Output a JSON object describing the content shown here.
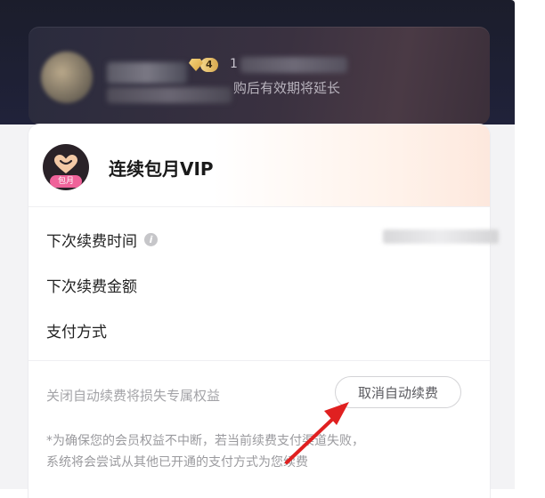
{
  "banner": {
    "level": "4",
    "level_prefix": "1",
    "description": "购后有效期将延长"
  },
  "vip_card": {
    "avatar_tag": "包月",
    "title": "连续包月VIP",
    "rows": [
      {
        "label": "下次续费时间"
      },
      {
        "label": "下次续费金额"
      },
      {
        "label": "支付方式"
      }
    ],
    "warning": "关闭自动续费将损失专属权益",
    "cancel_button": "取消自动续费",
    "note_line1": "*为确保您的会员权益不中断，若当前续费支付渠道失败，",
    "note_line2": "系统将会尝试从其他已开通的支付方式为您续费"
  },
  "colors": {
    "header_bg": "#1b1d2b",
    "accent_pink": "#f0639a",
    "arrow_red": "#e02020",
    "gold": "#d7a84e"
  },
  "icons": {
    "info": "info-icon",
    "heart": "heart-icon",
    "level_gem": "diamond-icon"
  }
}
